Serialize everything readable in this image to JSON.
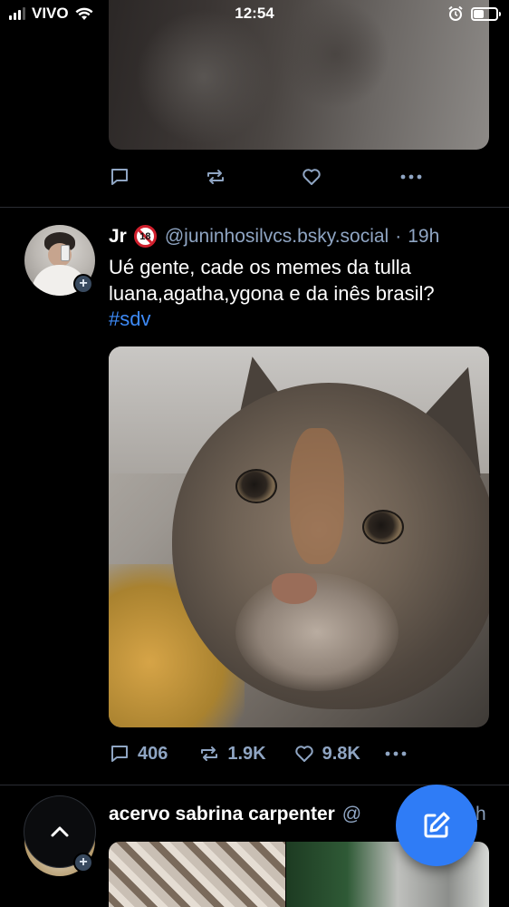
{
  "status_bar": {
    "carrier": "VIVO",
    "time": "12:54",
    "icons": [
      "signal-icon",
      "wifi-icon",
      "alarm-icon",
      "battery-icon"
    ],
    "battery_level": 0.45
  },
  "prev_post": {
    "image_alt": "cat photo",
    "actions": [
      "reply-icon",
      "repost-icon",
      "like-icon",
      "more-icon"
    ]
  },
  "post": {
    "author": "Jr",
    "age_badge": "18",
    "handle": "@juninhosilvcs.bsky.social",
    "separator": "·",
    "time": "19h",
    "text": "Ué gente, cade os memes da tulla luana,agatha,ygona e da inês brasil?",
    "hashtag": "#sdv",
    "stats": {
      "replies": "406",
      "reposts": "1.9K",
      "likes": "9.8K"
    }
  },
  "next_post": {
    "author": "acervo sabrina carpenter",
    "handle_partial": "@",
    "time_partial": "h"
  },
  "colors": {
    "background": "#000000",
    "muted": "#8fa5c3",
    "link": "#3d8af7",
    "fab": "#2f7cf6"
  }
}
